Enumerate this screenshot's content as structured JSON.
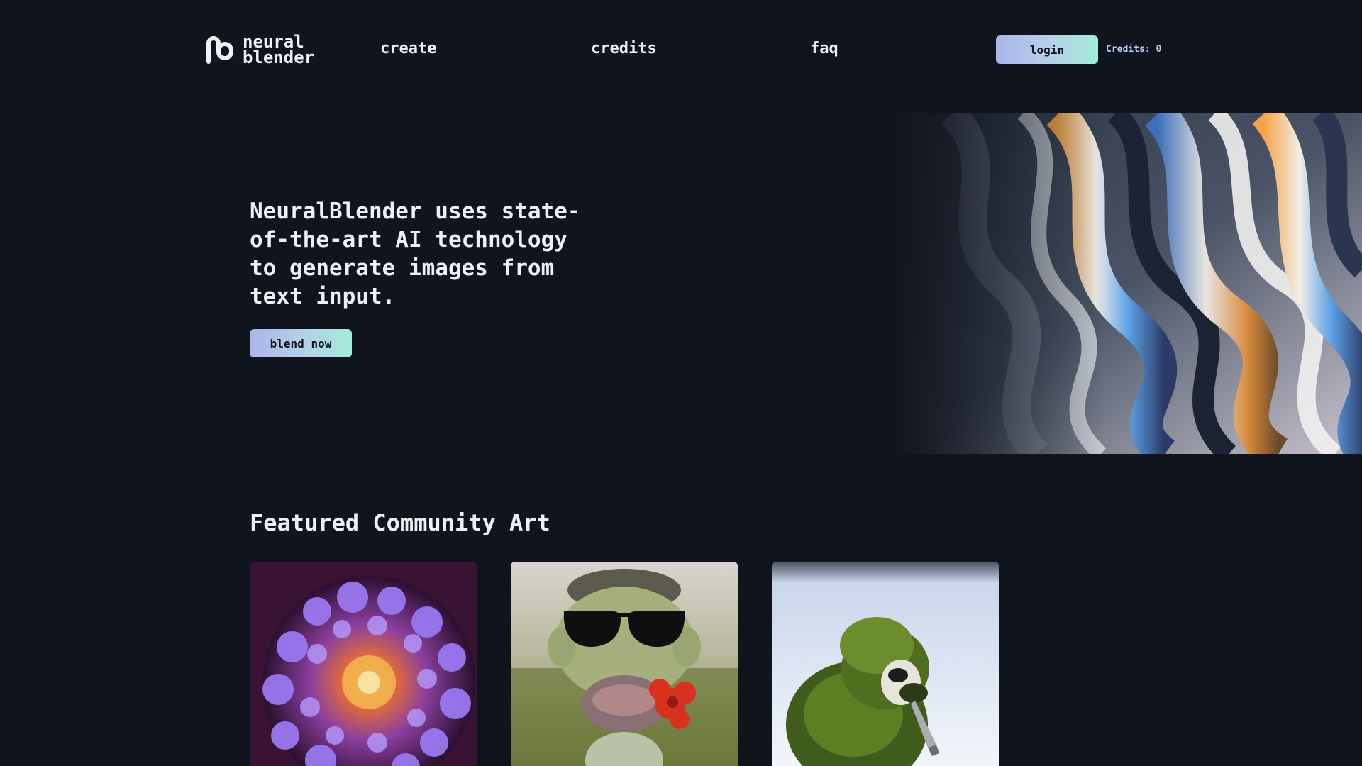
{
  "brand": {
    "line1": "neural",
    "line2": "blender",
    "logo_icon": "neural-blender-logo-icon"
  },
  "nav": {
    "create": "create",
    "credits": "credits",
    "faq": "faq",
    "login": "login",
    "credits_status": "Credits: 0"
  },
  "hero": {
    "heading": "NeuralBlender uses state-of-the-art AI technology to generate images from text input.",
    "cta": "blend now",
    "image": "iridescent-liquid-swirl-art"
  },
  "featured": {
    "title": "Featured Community Art",
    "cards": [
      {
        "image": "purple-sea-anemone-art"
      },
      {
        "image": "sunglasses-creature-with-red-flower-art"
      },
      {
        "image": "green-monkey-with-knife-art"
      }
    ]
  },
  "colors": {
    "background": "#10141d",
    "text": "#f0f2f5",
    "button_gradient_start": "#a8b6ea",
    "button_gradient_end": "#a3ecdc",
    "credits_text": "#b7ccf2"
  }
}
